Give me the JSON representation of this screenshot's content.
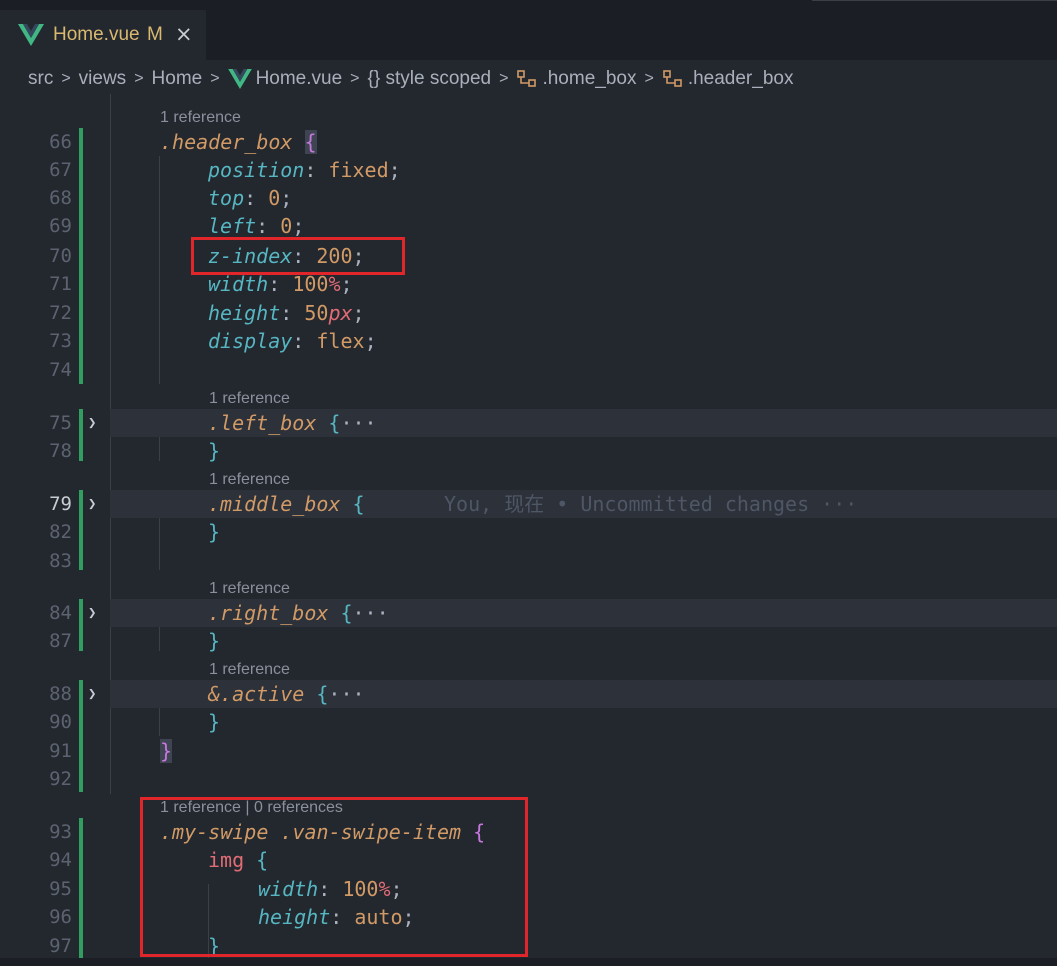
{
  "tab": {
    "name": "Home.vue",
    "modified": "M",
    "close": "×",
    "icon": "vue-logo-icon"
  },
  "breadcrumb": {
    "items": [
      "src",
      "views",
      "Home",
      "Home.vue",
      "{} style scoped",
      ".home_box",
      ".header_box"
    ],
    "separator": ">"
  },
  "lens": {
    "ref1": "1 reference",
    "ref_dual": "1 reference | 0 references"
  },
  "lines": {
    "l66": "66",
    "l67": "67",
    "l68": "68",
    "l69": "69",
    "l70": "70",
    "l71": "71",
    "l72": "72",
    "l73": "73",
    "l74": "74",
    "l75": "75",
    "l78": "78",
    "l79": "79",
    "l82": "82",
    "l83": "83",
    "l84": "84",
    "l87": "87",
    "l88": "88",
    "l90": "90",
    "l91": "91",
    "l92": "92",
    "l93": "93",
    "l94": "94",
    "l95": "95",
    "l96": "96",
    "l97": "97"
  },
  "code": {
    "header_sel": ".header_box",
    "position_prop": "position",
    "position_val": "fixed",
    "top_prop": "top",
    "top_val": "0",
    "left_prop": "left",
    "left_val": "0",
    "zindex_prop": "z-index",
    "zindex_val": "200",
    "width_prop": "width",
    "width_val": "100",
    "pct": "%",
    "height_prop": "height",
    "height_val": "50",
    "px": "px",
    "display_prop": "display",
    "display_val": "flex",
    "left_box": ".left_box",
    "middle_box": ".middle_box",
    "blame": "You, 现在 • Uncommitted changes",
    "right_box": ".right_box",
    "active": "&.active",
    "swipe_sel1": ".my-swipe",
    "swipe_sel2": ".van-swipe-item",
    "img": "img",
    "auto_val": "auto",
    "ellipsis": "···"
  },
  "colors": {
    "accent_green": "#2f9e5f",
    "highlight_red": "#e0262b",
    "tab_text": "#d9b870"
  }
}
